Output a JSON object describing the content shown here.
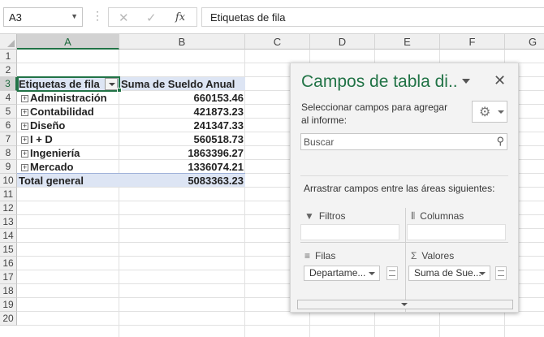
{
  "formula_bar": {
    "name_box": "A3",
    "formula_content": "Etiquetas de fila",
    "cancel_icon": "close-icon",
    "enter_icon": "check-icon",
    "function_label": "fx"
  },
  "columns": [
    "A",
    "B",
    "C",
    "D",
    "E",
    "F",
    "G"
  ],
  "rows": [
    "1",
    "2",
    "3",
    "4",
    "5",
    "6",
    "7",
    "8",
    "9",
    "10",
    "11",
    "12",
    "13",
    "14",
    "15",
    "16",
    "17",
    "18",
    "19",
    "20"
  ],
  "pivot": {
    "row_label_header": "Etiquetas de fila",
    "value_header": "Suma de Sueldo Anual",
    "expand_symbol": "+",
    "items": [
      {
        "label": "Administración",
        "value": "660153.46"
      },
      {
        "label": "Contabilidad",
        "value": "421873.23"
      },
      {
        "label": "Diseño",
        "value": "241347.33"
      },
      {
        "label": "I + D",
        "value": "560518.73"
      },
      {
        "label": "Ingeniería",
        "value": "1863396.27"
      },
      {
        "label": "Mercado",
        "value": "1336074.21"
      }
    ],
    "total_label": "Total general",
    "total_value": "5083363.23"
  },
  "field_panel": {
    "title": "Campos de tabla di..",
    "subtitle": "Seleccionar campos para agregar al informe:",
    "search_placeholder": "Buscar",
    "drag_instructions": "Arrastrar campos entre las áreas siguientes:",
    "areas": {
      "filters": "Filtros",
      "columns": "Columnas",
      "rows": "Filas",
      "values": "Valores"
    },
    "rows_field": "Departame...",
    "values_field": "Suma de Sue..."
  },
  "colors": {
    "accent": "#217346",
    "pivot_band": "#dde5f4"
  }
}
